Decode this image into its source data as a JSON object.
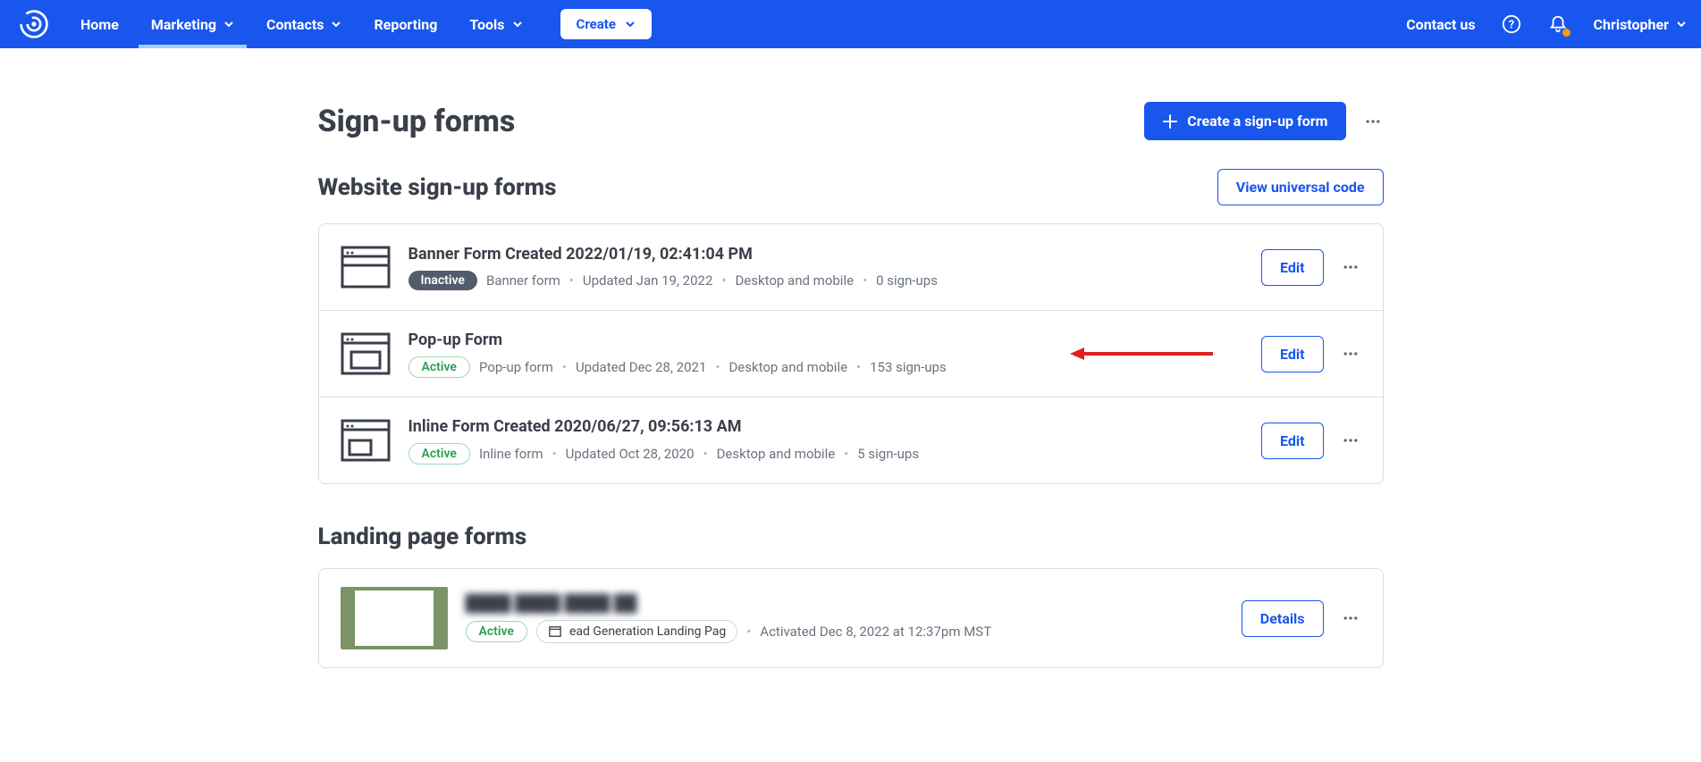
{
  "nav": {
    "home": "Home",
    "marketing": "Marketing",
    "contacts": "Contacts",
    "reporting": "Reporting",
    "tools": "Tools",
    "create": "Create",
    "contact_us": "Contact us",
    "username": "Christopher"
  },
  "page": {
    "title": "Sign-up forms",
    "create_button": "Create a sign-up form"
  },
  "sections": {
    "website": {
      "title": "Website sign-up forms",
      "universal_btn": "View universal code",
      "forms": [
        {
          "name": "Banner Form Created 2022/01/19, 02:41:04 PM",
          "status": "Inactive",
          "status_class": "inactive",
          "type": "Banner form",
          "updated": "Updated Jan 19, 2022",
          "devices": "Desktop and mobile",
          "signups": "0 sign-ups",
          "icon": "banner"
        },
        {
          "name": "Pop-up Form",
          "status": "Active",
          "status_class": "active",
          "type": "Pop-up form",
          "updated": "Updated Dec 28, 2021",
          "devices": "Desktop and mobile",
          "signups": "153 sign-ups",
          "icon": "popup"
        },
        {
          "name": "Inline Form Created 2020/06/27, 09:56:13 AM",
          "status": "Active",
          "status_class": "active",
          "type": "Inline form",
          "updated": "Updated Oct 28, 2020",
          "devices": "Desktop and mobile",
          "signups": "5 sign-ups",
          "icon": "inline"
        }
      ]
    },
    "landing": {
      "title": "Landing page forms",
      "forms": [
        {
          "name_blurred": "████ ████ ████ ██",
          "status": "Active",
          "status_class": "active",
          "chip_label": "ead Generation Landing Pag",
          "activated": "Activated Dec 8, 2022 at 12:37pm MST"
        }
      ]
    }
  },
  "actions": {
    "edit": "Edit",
    "details": "Details"
  }
}
